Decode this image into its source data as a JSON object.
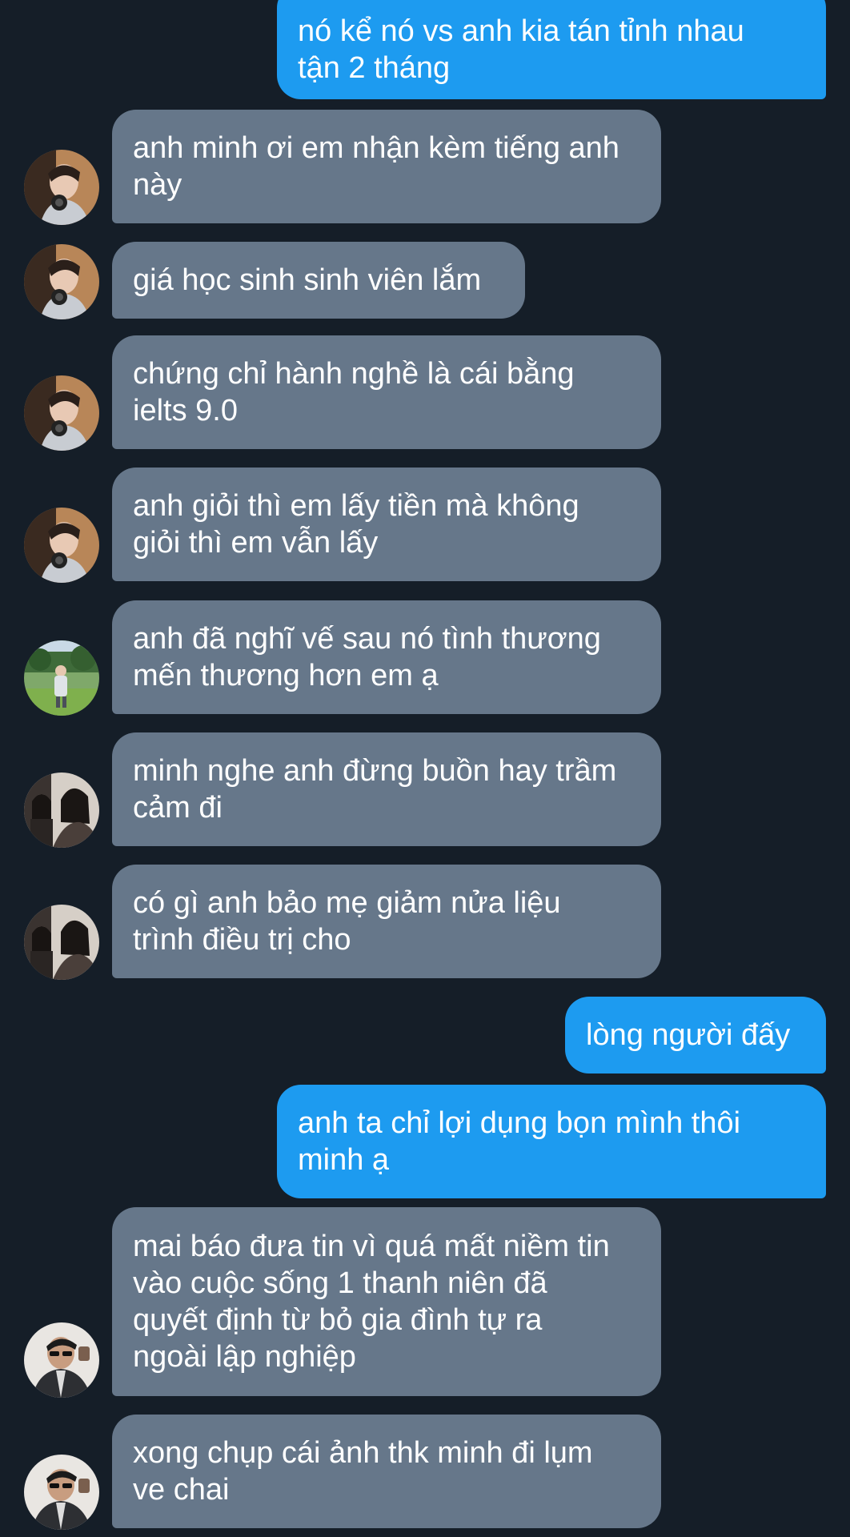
{
  "colors": {
    "background": "#151e28",
    "incoming_bubble": "#66778a",
    "outgoing_bubble": "#1d9bf0",
    "text": "#ffffff"
  },
  "messages": [
    {
      "direction": "out",
      "text": "nó kể nó vs anh kia tán tỉnh nhau\ntận 2 tháng"
    },
    {
      "direction": "in",
      "avatar": "avatar-a",
      "text": "anh minh ơi em nhận kèm tiếng anh\nnày"
    },
    {
      "direction": "in",
      "avatar": "avatar-a",
      "text": "giá học sinh sinh viên lắm"
    },
    {
      "direction": "in",
      "avatar": "avatar-a",
      "text": "chứng chỉ hành nghề là cái bằng\nielts 9.0"
    },
    {
      "direction": "in",
      "avatar": "avatar-a",
      "text": "anh giỏi thì em lấy tiền mà không\ngiỏi thì em vẫn lấy"
    },
    {
      "direction": "in",
      "avatar": "avatar-b",
      "text": "anh đã nghĩ vế sau nó tình thương\nmến thương hơn em ạ"
    },
    {
      "direction": "in",
      "avatar": "avatar-c",
      "text": "minh nghe anh đừng buồn hay trầm\ncảm đi"
    },
    {
      "direction": "in",
      "avatar": "avatar-c",
      "text": "có gì anh bảo mẹ giảm nửa liệu\ntrình điều trị cho"
    },
    {
      "direction": "out",
      "text": "lòng người đấy"
    },
    {
      "direction": "out",
      "text": "anh ta chỉ lợi dụng bọn mình thôi\nminh ạ"
    },
    {
      "direction": "in",
      "avatar": "avatar-d",
      "text": "mai báo đưa tin vì quá mất niềm tin\nvào cuộc sống 1 thanh niên đã\nquyết định từ bỏ gia đình tự ra\nngoài lập nghiệp"
    },
    {
      "direction": "in",
      "avatar": "avatar-d",
      "text": "xong chụp cái ảnh thk minh đi lụm\nve chai"
    }
  ]
}
